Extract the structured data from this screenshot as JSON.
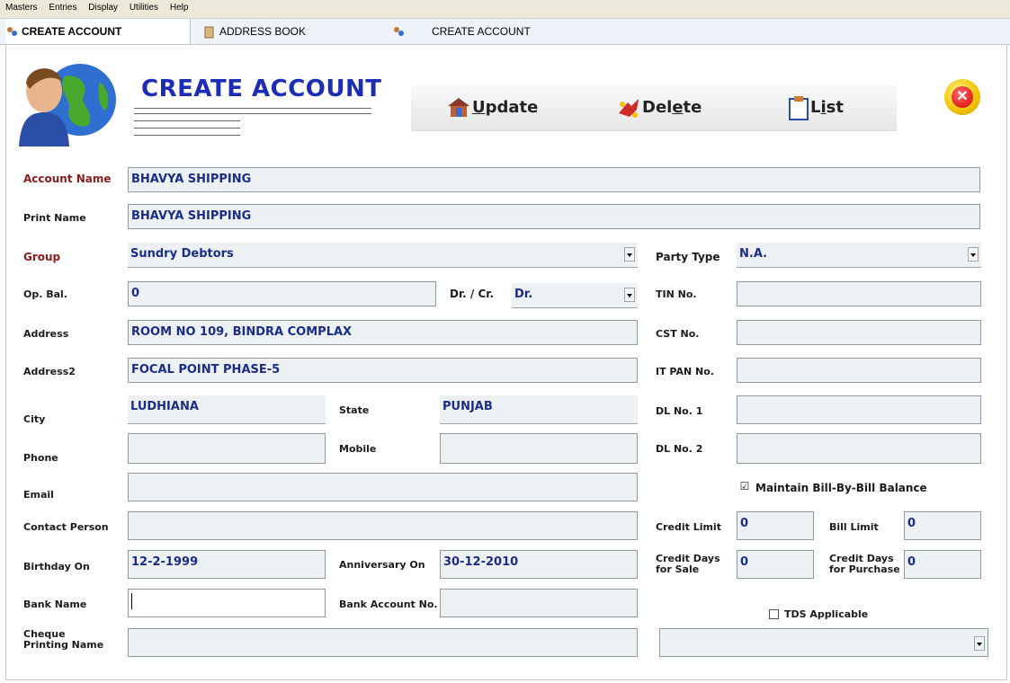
{
  "menu": [
    "Masters",
    "Entries",
    "Display",
    "Utilities",
    "Help"
  ],
  "tabs": [
    {
      "label": "CREATE ACCOUNT",
      "icon": "people-icon"
    },
    {
      "label": "ADDRESS BOOK",
      "icon": "book-icon"
    },
    {
      "label": "CREATE ACCOUNT",
      "icon": "people-icon"
    }
  ],
  "page_title": "CREATE ACCOUNT",
  "toolbar": {
    "update_pre": "",
    "update_u": "U",
    "update_post": "pdate",
    "delete_pre": "Del",
    "delete_u": "e",
    "delete_post": "te",
    "list_pre": "L",
    "list_u": "i",
    "list_post": "st"
  },
  "close_glyph": "✕",
  "labels": {
    "account_name": "Account Name",
    "print_name": "Print Name",
    "group": "Group",
    "party_type": "Party Type",
    "op_bal": "Op. Bal.",
    "dr_cr": "Dr. / Cr.",
    "tin": "TIN No.",
    "address": "Address",
    "cst": "CST No.",
    "address2": "Address2",
    "it_pan": "IT PAN No.",
    "city": "City",
    "state": "State",
    "dl1": "DL No. 1",
    "phone": "Phone",
    "mobile": "Mobile",
    "dl2": "DL No. 2",
    "email": "Email",
    "maintain_bill": "Maintain Bill-By-Bill Balance",
    "contact_person": "Contact Person",
    "credit_limit": "Credit Limit",
    "bill_limit": "Bill Limit",
    "birthday": "Birthday On",
    "anniversary": "Anniversary On",
    "credit_days_sale_1": "Credit Days",
    "credit_days_sale_2": "for Sale",
    "credit_days_purchase_1": "Credit Days",
    "credit_days_purchase_2": "for Purchase",
    "bank_name": "Bank Name",
    "bank_account": "Bank Account No.",
    "tds": "TDS Applicable",
    "cheque_1": "Cheque",
    "cheque_2": "Printing Name"
  },
  "values": {
    "account_name": "BHAVYA SHIPPING",
    "print_name": "BHAVYA SHIPPING",
    "group": "Sundry Debtors",
    "party_type": "N.A.",
    "op_bal": "0",
    "dr_cr": "Dr.",
    "tin": "",
    "address": "ROOM NO 109, BINDRA COMPLAX",
    "cst": "",
    "address2": "FOCAL POINT PHASE-5",
    "it_pan": "",
    "city": "LUDHIANA",
    "state": "PUNJAB",
    "dl1": "",
    "phone": "",
    "mobile": "",
    "dl2": "",
    "email": "",
    "maintain_bill_checked": "☑",
    "contact_person": "",
    "credit_limit": "0",
    "bill_limit": "0",
    "birthday": "12-2-1999",
    "anniversary": "30-12-2010",
    "credit_days_sale": "0",
    "credit_days_purchase": "0",
    "bank_name": "",
    "bank_account": "",
    "tds_checked": "",
    "cheque_name": "",
    "bottom_select": ""
  }
}
